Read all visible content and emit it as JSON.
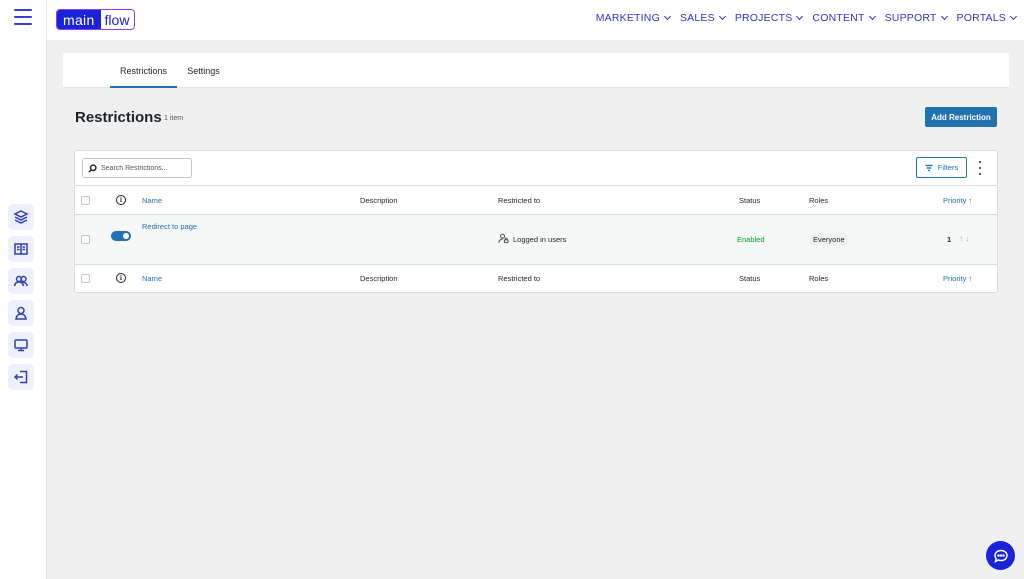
{
  "app": {
    "logo": {
      "part1": "main",
      "part2": "flow"
    },
    "nav": [
      "MARKETING",
      "SALES",
      "PROJECTS",
      "CONTENT",
      "SUPPORT",
      "PORTALS"
    ]
  },
  "rail_icons": [
    "layers-icon",
    "book-icon",
    "users-icon",
    "user-icon",
    "monitor-icon",
    "logout-icon"
  ],
  "tabs": [
    "Restrictions",
    "Settings"
  ],
  "page": {
    "title": "Restrictions",
    "count": "1 item",
    "add_button": "Add Restriction"
  },
  "toolbar": {
    "search_placeholder": "Search Restrictions...",
    "filters_label": "Filters"
  },
  "table": {
    "columns": {
      "name": "Name",
      "description": "Description",
      "restricted_to": "Restricted to",
      "status": "Status",
      "roles": "Roles",
      "priority": "Priority ↑"
    },
    "rows": [
      {
        "name": "Redirect to page",
        "description": "",
        "restricted_to": "Logged in users",
        "status": "Enabled",
        "roles": "Everyone",
        "priority": "1",
        "priority_arrows": "↑  ↓"
      }
    ]
  },
  "colors": {
    "brand": "#1a23d8",
    "accent": "#2271b1",
    "success": "#00a32a"
  }
}
